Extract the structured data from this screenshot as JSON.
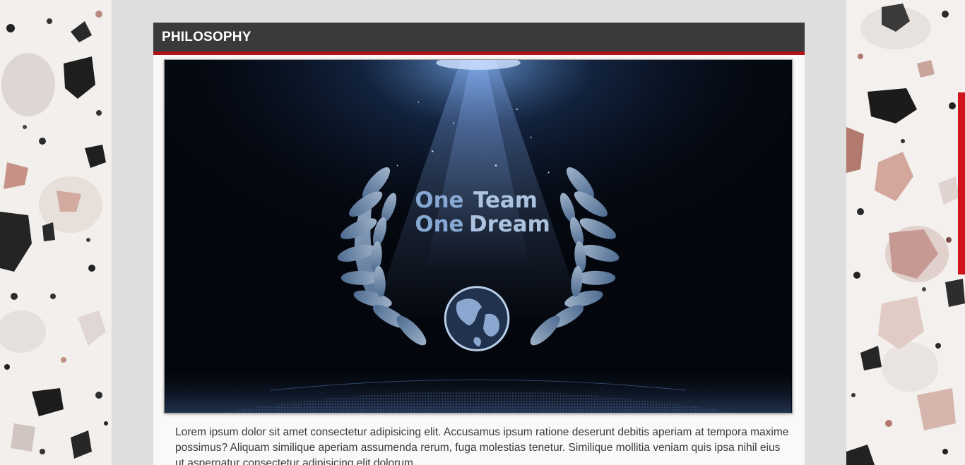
{
  "section": {
    "title": "PHILOSOPHY",
    "body": "Lorem ipsum dolor sit amet consectetur adipisicing elit. Accusamus ipsum ratione deserunt debitis aperiam at tempora maxime possimus? Aliquam similique aperiam assumenda rerum, fuga molestias tenetur. Similique mollitia veniam quis ipsa nihil eius ut aspernatur consectetur adipisicing elit dolorum."
  },
  "hero_image": {
    "line1_a": "One",
    "line1_b": "Team",
    "line2_a": "One",
    "line2_b": "Dream"
  },
  "colors": {
    "header_bg": "#3a3a3a",
    "accent_red": "#b51218",
    "page_bg": "#dedede"
  },
  "icons": {
    "emblem": "laurel-wreath-globe-icon"
  }
}
